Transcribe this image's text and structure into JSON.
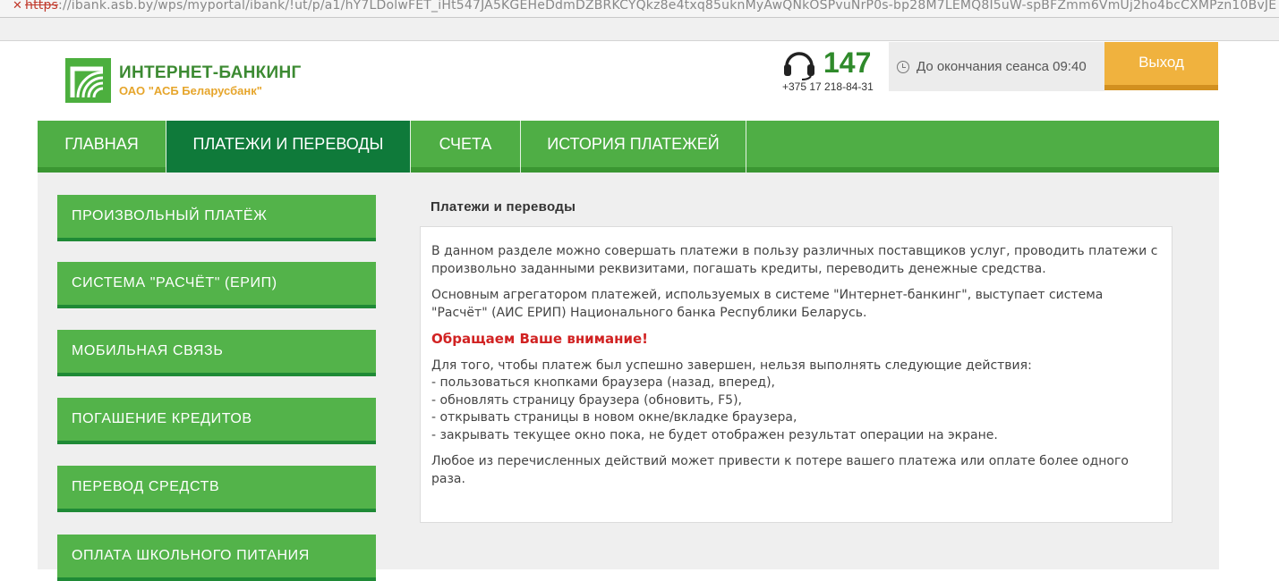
{
  "browser": {
    "url_protocol": "https",
    "url_rest": "://ibank.asb.by/wps/myportal/ibank/!ut/p/a1/hY7LDolwFET_iHt547JA5KGEHeDdmDZBRKCYQkz8e4txq85uknMyAwQNkOSPvuNrP0s-bp28M7LEMQ8I5uW-spBFZmm6VmUj2ho4bcCXMPzn10BvJE"
  },
  "header": {
    "logo_title": "ИНТЕРНЕТ-БАНКИНГ",
    "logo_subtitle": "ОАО \"АСБ Беларусбанк\"",
    "phone_short": "147",
    "phone_full": "+375 17 218-84-31",
    "session_text": "До окончания сеанса 09:40",
    "logout_label": "Выход"
  },
  "nav": {
    "items": [
      {
        "label": "ГЛАВНАЯ"
      },
      {
        "label": "ПЛАТЕЖИ И ПЕРЕВОДЫ"
      },
      {
        "label": "СЧЕТА"
      },
      {
        "label": "ИСТОРИЯ ПЛАТЕЖЕЙ"
      }
    ],
    "active": "ПЛАТЕЖИ И ПЕРЕВОДЫ"
  },
  "sidebar": {
    "items": [
      {
        "label": "ПРОИЗВОЛЬНЫЙ ПЛАТЁЖ"
      },
      {
        "label": "СИСТЕМА \"РАСЧЁТ\" (ЕРИП)"
      },
      {
        "label": "МОБИЛЬНАЯ СВЯЗЬ"
      },
      {
        "label": "ПОГАШЕНИЕ КРЕДИТОВ"
      },
      {
        "label": "ПЕРЕВОД СРЕДСТВ"
      },
      {
        "label": "ОПЛАТА ШКОЛЬНОГО ПИТАНИЯ"
      }
    ]
  },
  "main": {
    "title": "Платежи и переводы",
    "paragraph1": "В данном разделе можно совершать платежи в пользу различных поставщиков услуг, проводить платежи с произвольно заданными реквизитами, погашать кредиты, переводить денежные средства.",
    "paragraph2": "Основным агрегатором платежей, используемых в системе \"Интернет-банкинг\", выступает система \"Расчёт\" (АИС ЕРИП) Национального банка Республики Беларусь.",
    "warning": "Обращаем Ваше внимание!",
    "rules_intro": "Для того, чтобы платеж был успешно завершен, нельзя выполнять следующие действия:",
    "rules": [
      "- пользоваться кнопками браузера (назад, вперед),",
      "- обновлять страницу браузера (обновить, F5),",
      "- открывать страницы в новом окне/вкладке браузера,",
      "- закрывать текущее окно пока, не будет отображен результат операции на экране."
    ],
    "closing": "Любое из перечисленных действий может привести к потере вашего платежа или оплате более одного раза."
  },
  "colors": {
    "green": "#4fae45",
    "active_nav": "#0f7a3a",
    "logout": "#f0b23e",
    "warning": "#d12222"
  }
}
